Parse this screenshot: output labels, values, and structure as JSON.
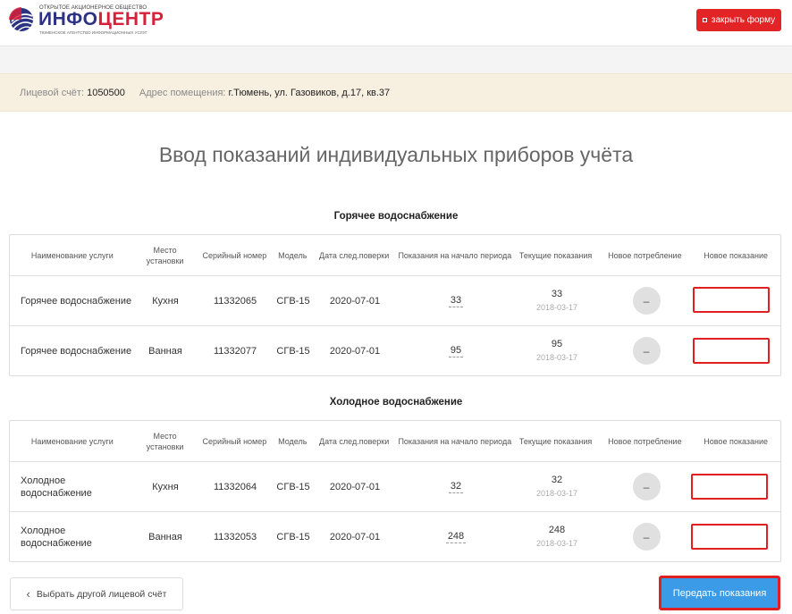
{
  "header": {
    "logo_top": "Открытое акционерное общество",
    "logo_main_a": "ИНФО",
    "logo_main_b": "ЦЕНТР",
    "logo_sub": "Тюменское агентство информационных услуг",
    "close_label": "закрыть форму"
  },
  "account": {
    "account_label": "Лицевой счёт:",
    "account_value": "1050500",
    "address_label": "Адрес помещения:",
    "address_value": "г.Тюмень, ул. Газовиков, д.17, кв.37"
  },
  "page_title": "Ввод показаний индивидуальных приборов учёта",
  "columns": {
    "name": "Наименование услуги",
    "place": "Место установки",
    "serial": "Серийный номер",
    "model": "Модель",
    "check_date": "Дата след.поверки",
    "start": "Показания на начало периода",
    "current": "Текущие показания",
    "consumption": "Новое потребление",
    "new_reading": "Новое показание"
  },
  "hot": {
    "title": "Горячее водоснабжение",
    "rows": [
      {
        "name": "Горячее водоснабжение",
        "place": "Кухня",
        "serial": "11332065",
        "model": "СГВ-15",
        "check_date": "2020-07-01",
        "start": "33",
        "current": "33",
        "current_date": "2018-03-17",
        "consumption": "–",
        "new_value": ""
      },
      {
        "name": "Горячее водоснабжение",
        "place": "Ванная",
        "serial": "11332077",
        "model": "СГВ-15",
        "check_date": "2020-07-01",
        "start": "95",
        "current": "95",
        "current_date": "2018-03-17",
        "consumption": "–",
        "new_value": ""
      }
    ]
  },
  "cold": {
    "title": "Холодное водоснабжение",
    "rows": [
      {
        "name": "Холодное водоснабжение",
        "place": "Кухня",
        "serial": "11332064",
        "model": "СГВ-15",
        "check_date": "2020-07-01",
        "start": "32",
        "current": "32",
        "current_date": "2018-03-17",
        "consumption": "–",
        "new_value": ""
      },
      {
        "name": "Холодное водоснабжение",
        "place": "Ванная",
        "serial": "11332053",
        "model": "СГВ-15",
        "check_date": "2020-07-01",
        "start": "248",
        "current": "248",
        "current_date": "2018-03-17",
        "consumption": "–",
        "new_value": ""
      }
    ]
  },
  "footer": {
    "back_icon": "chevron-left-icon",
    "back_label": "Выбрать другой лицевой счёт",
    "submit_label": "Передать показания"
  },
  "colors": {
    "brand_blue": "#2c3383",
    "brand_red": "#d7203a",
    "close_button": "#e22427",
    "submit_button": "#3c9be6",
    "highlight_red": "#e02020",
    "account_bar": "#f7f0e1"
  }
}
